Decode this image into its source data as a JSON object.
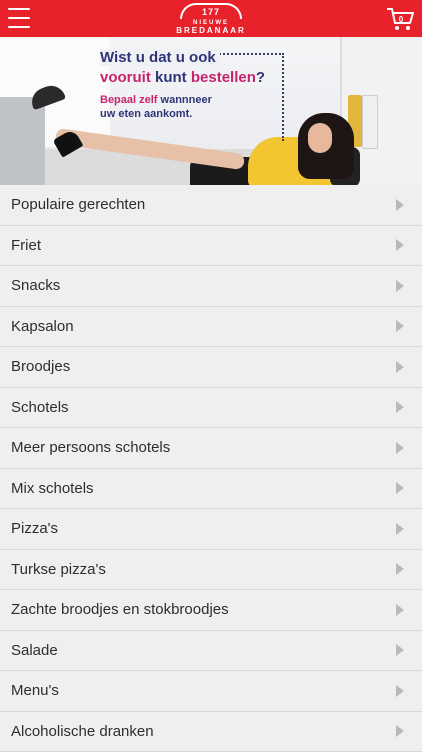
{
  "header": {
    "logo_top": "177",
    "logo_line1": "NIEUWE",
    "logo_line2": "BREDANAAR",
    "cart_count": "0",
    "icons": {
      "menu": "hamburger-icon",
      "cart": "shopping-cart-icon"
    },
    "brand_color": "#e8222b"
  },
  "banner": {
    "line1": "Wist u dat u ook",
    "line2_a": "vooruit",
    "line2_b": "kunt",
    "line2_c": "bestellen",
    "line2_d": "?",
    "line3_a": "Bepaal zelf",
    "line3_b": "wannneer",
    "line4": "uw eten aankomt.",
    "colors": {
      "navy": "#2f3578",
      "pink": "#c7246f"
    }
  },
  "menu": {
    "items": [
      {
        "label": "Populaire gerechten"
      },
      {
        "label": "Friet"
      },
      {
        "label": "Snacks"
      },
      {
        "label": "Kapsalon"
      },
      {
        "label": "Broodjes"
      },
      {
        "label": "Schotels"
      },
      {
        "label": "Meer persoons schotels"
      },
      {
        "label": "Mix schotels"
      },
      {
        "label": "Pizza's"
      },
      {
        "label": "Turkse pizza's"
      },
      {
        "label": "Zachte broodjes en stokbroodjes"
      },
      {
        "label": "Salade"
      },
      {
        "label": "Menu's"
      },
      {
        "label": "Alcoholische dranken"
      }
    ]
  }
}
